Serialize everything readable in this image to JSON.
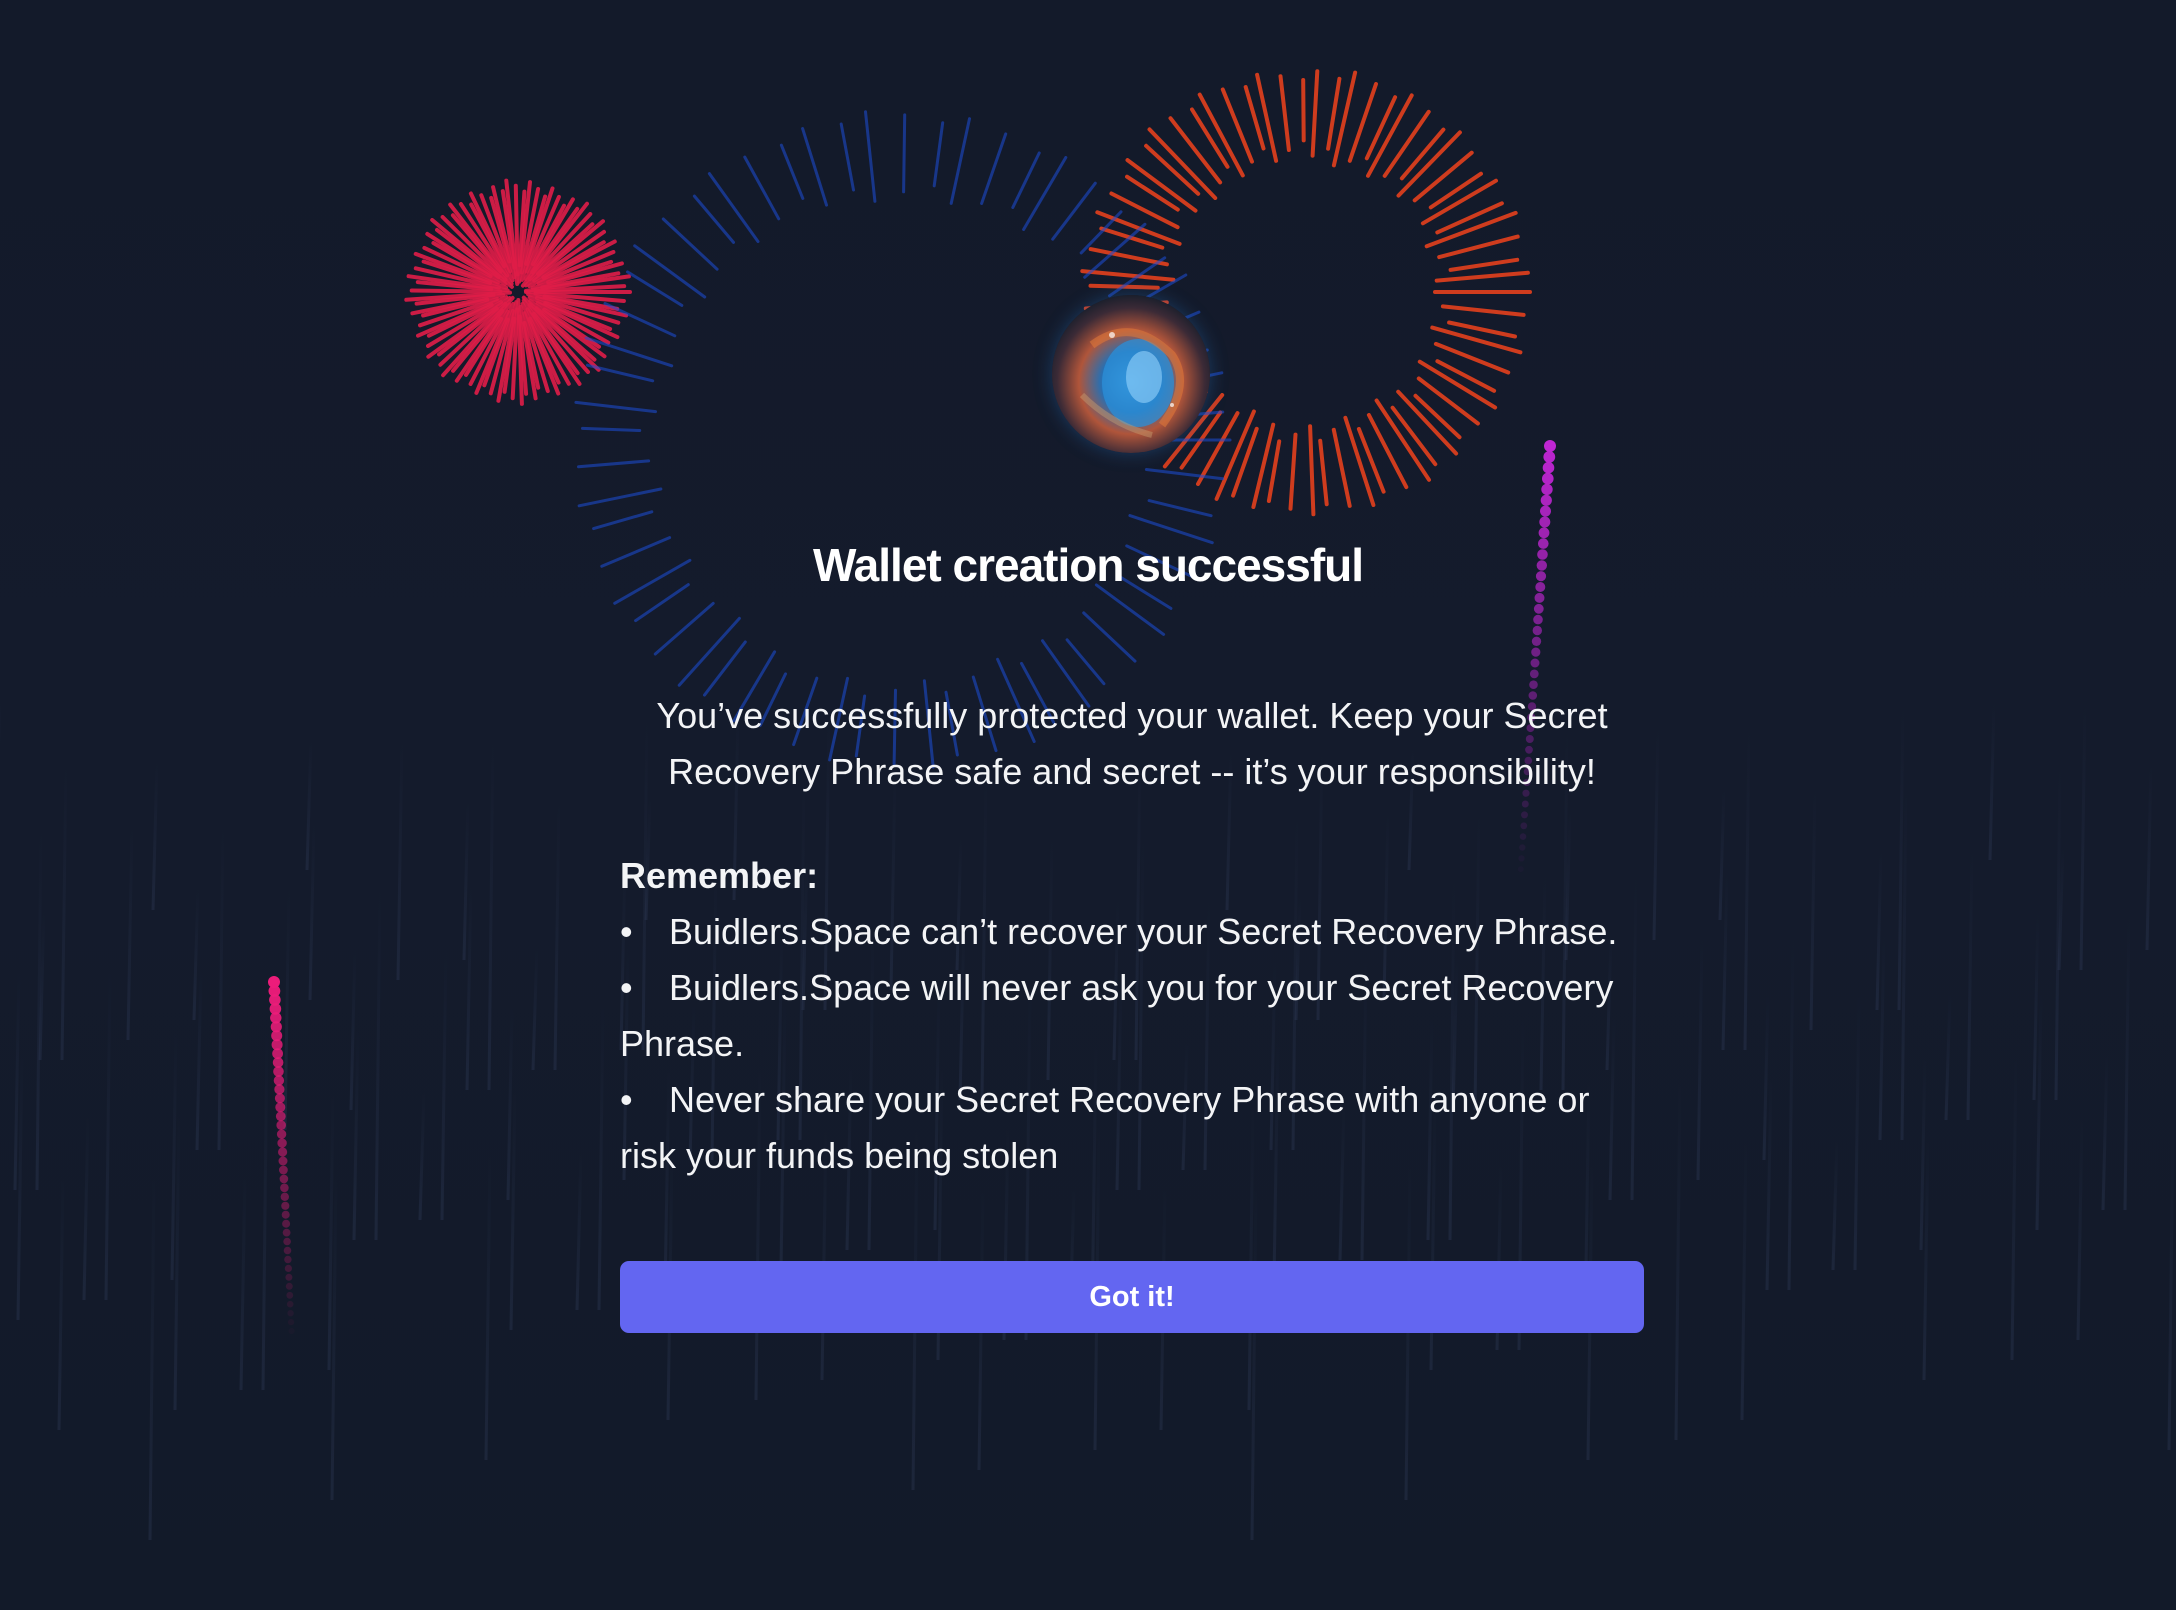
{
  "success": {
    "title": "Wallet creation successful",
    "intro": "You’ve successfully protected your wallet. Keep your Secret Recovery Phrase safe and secret -- it’s your responsibility!",
    "remember_label": "Remember:",
    "bullets": [
      "Buidlers.Space can’t recover your Secret Recovery Phrase.",
      "Buidlers.Space will never ask you for your Secret Recovery Phrase.",
      "Never share your Secret Recovery Phrase with anyone or risk your funds being stolen"
    ],
    "bullet_char": "•",
    "button_label": "Got it!"
  },
  "colors": {
    "background": "#131a2b",
    "button": "#6366f1",
    "text": "#ffffff",
    "firework_red": "#e11d48",
    "firework_orange": "#f0421c",
    "firework_blue": "#1d4ed8",
    "trail_magenta": "#c026d3",
    "trail_pink": "#ec1c7a"
  },
  "icons": {
    "avatar": "nebula-avatar-image"
  }
}
